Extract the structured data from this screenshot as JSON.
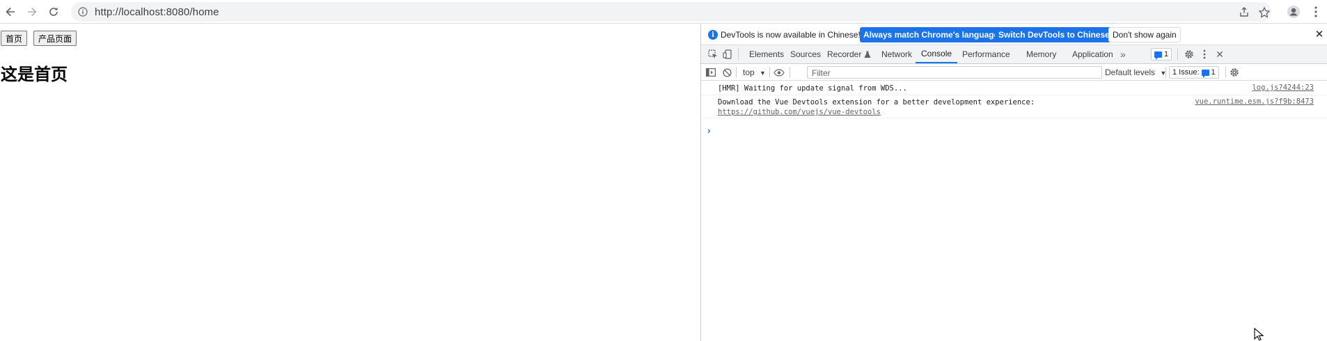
{
  "browser": {
    "url": "http://localhost:8080/home"
  },
  "page": {
    "buttons": [
      "首页",
      "产品页面"
    ],
    "heading": "这是首页"
  },
  "devtools": {
    "infobar": {
      "message": "DevTools is now available in Chinese!",
      "match_language_label": "Always match Chrome's language",
      "switch_label": "Switch DevTools to Chinese",
      "dont_show_label": "Don't show again"
    },
    "tabs": [
      "Elements",
      "Sources",
      "Recorder",
      "Network",
      "Console",
      "Performance",
      "Memory",
      "Application"
    ],
    "active_tab": "Console",
    "issues_count": "1",
    "console_toolbar": {
      "context": "top",
      "filter_placeholder": "Filter",
      "levels": "Default levels",
      "issues_label": "1 Issue:",
      "issues_count": "1"
    },
    "logs": [
      {
        "text": "[HMR] Waiting for update signal from WDS...",
        "link": "",
        "source": "log.js?4244:23"
      },
      {
        "text": "Download the Vue Devtools extension for a better development experience:",
        "link": "https://github.com/vuejs/vue-devtools",
        "source": "vue.runtime.esm.js?f9b:8473"
      }
    ]
  },
  "colors": {
    "accent": "#1a73e8",
    "toolbar_bg": "#f1f3f4",
    "border": "#cbcdd1"
  }
}
